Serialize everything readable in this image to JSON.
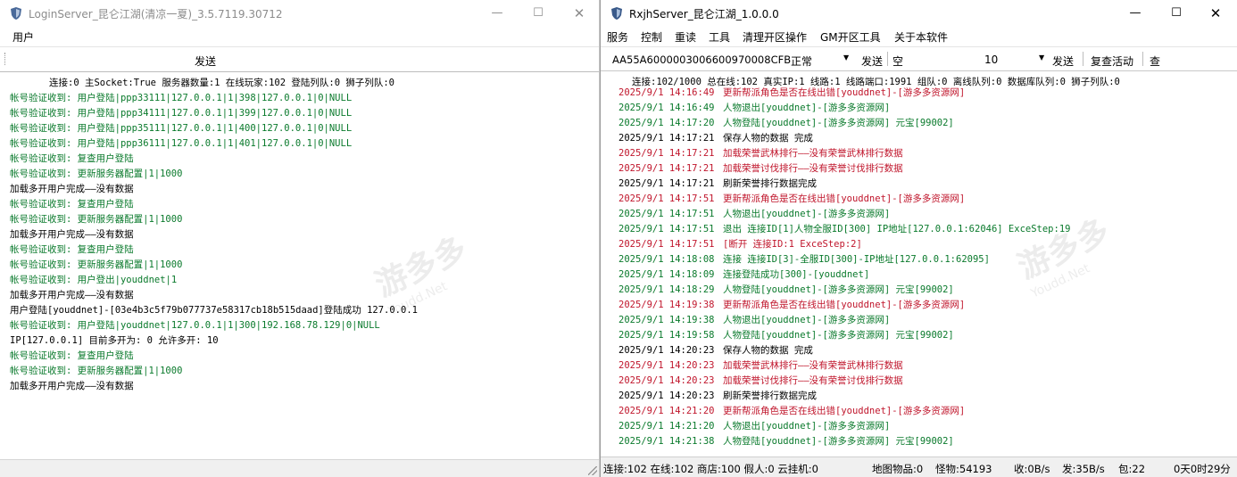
{
  "left_window": {
    "title": "LoginServer_昆仑江湖(清凉一夏)_3.5.7119.30712",
    "menu": [
      "用户"
    ],
    "send_label": "发送",
    "status_header": "连接:0  主Socket:True  服务器数量:1  在线玩家:102  登陆列队:0  狮子列队:0",
    "log": [
      {
        "text": "帐号验证收到: 用户登陆|ppp33111|127.0.0.1|1|398|127.0.0.1|0|NULL",
        "color": "green"
      },
      {
        "text": "帐号验证收到: 用户登陆|ppp34111|127.0.0.1|1|399|127.0.0.1|0|NULL",
        "color": "green"
      },
      {
        "text": "帐号验证收到: 用户登陆|ppp35111|127.0.0.1|1|400|127.0.0.1|0|NULL",
        "color": "green"
      },
      {
        "text": "帐号验证收到: 用户登陆|ppp36111|127.0.0.1|1|401|127.0.0.1|0|NULL",
        "color": "green"
      },
      {
        "text": "帐号验证收到: 复查用户登陆",
        "color": "green"
      },
      {
        "text": "帐号验证收到: 更新服务器配置|1|1000",
        "color": "green"
      },
      {
        "text": "加载多开用户完成——没有数据",
        "color": "black"
      },
      {
        "text": "帐号验证收到: 复查用户登陆",
        "color": "green"
      },
      {
        "text": "帐号验证收到: 更新服务器配置|1|1000",
        "color": "green"
      },
      {
        "text": "加载多开用户完成——没有数据",
        "color": "black"
      },
      {
        "text": "帐号验证收到: 复查用户登陆",
        "color": "green"
      },
      {
        "text": "帐号验证收到: 更新服务器配置|1|1000",
        "color": "green"
      },
      {
        "text": "帐号验证收到: 用户登出|youddnet|1",
        "color": "green"
      },
      {
        "text": "加载多开用户完成——没有数据",
        "color": "black"
      },
      {
        "text": "用户登陆[youddnet]-[03e4b3c5f79b077737e58317cb18b515daad]登陆成功    127.0.0.1",
        "color": "black"
      },
      {
        "text": "帐号验证收到: 用户登陆|youddnet|127.0.0.1|1|300|192.168.78.129|0|NULL",
        "color": "green"
      },
      {
        "text": "IP[127.0.0.1]  目前多开为: 0  允许多开: 10",
        "color": "black"
      },
      {
        "text": "帐号验证收到: 复查用户登陆",
        "color": "green"
      },
      {
        "text": "帐号验证收到: 更新服务器配置|1|1000",
        "color": "green"
      },
      {
        "text": "加载多开用户完成——没有数据",
        "color": "black"
      }
    ]
  },
  "right_window": {
    "title": "RxjhServer_昆仑江湖_1.0.0.0",
    "menu": [
      "服务",
      "控制",
      "重读",
      "工具",
      "清理开区操作",
      "GM开区工具",
      "关于本软件"
    ],
    "toolbar": {
      "code": "AA55A6000003006600970008CFB",
      "mode_value": "正常",
      "send1": "发送",
      "input_value": "空",
      "count_value": "10",
      "send2": "发送",
      "recheck": "复查活动",
      "query": "查"
    },
    "status_header": "连接:102/1000   总在线:102  真实IP:1  线路:1  线路端口:1991  组队:0  离线队列:0  数据库队列:0  狮子列队:0",
    "log": [
      {
        "time": "2025/9/1  14:16:49",
        "text": "更新帮派角色是否在线出错[youddnet]-[游多多资源网]",
        "color": "red"
      },
      {
        "time": "2025/9/1  14:16:49",
        "text": "人物退出[youddnet]-[游多多资源网]",
        "color": "green"
      },
      {
        "time": "2025/9/1  14:17:20",
        "text": "人物登陆[youddnet]-[游多多资源网] 元宝[99002]",
        "color": "green"
      },
      {
        "time": "2025/9/1  14:17:21",
        "text": "保存人物的数据  完成",
        "color": "black"
      },
      {
        "time": "2025/9/1  14:17:21",
        "text": "加载荣誉武林排行——没有荣誉武林排行数据",
        "color": "red"
      },
      {
        "time": "2025/9/1  14:17:21",
        "text": "加载荣誉讨伐排行——没有荣誉讨伐排行数据",
        "color": "red"
      },
      {
        "time": "2025/9/1  14:17:21",
        "text": "刷新荣誉排行数据完成",
        "color": "black"
      },
      {
        "time": "2025/9/1  14:17:51",
        "text": "更新帮派角色是否在线出错[youddnet]-[游多多资源网]",
        "color": "red"
      },
      {
        "time": "2025/9/1  14:17:51",
        "text": "人物退出[youddnet]-[游多多资源网]",
        "color": "green"
      },
      {
        "time": "2025/9/1  14:17:51",
        "text": "退出 连接ID[1]人物全服ID[300] IP地址[127.0.0.1:62046] ExceStep:19",
        "color": "green"
      },
      {
        "time": "2025/9/1  14:17:51",
        "text": "[断开 连接ID:1 ExceStep:2]",
        "color": "red"
      },
      {
        "time": "2025/9/1  14:18:08",
        "text": "连接 连接ID[3]-全服ID[300]-IP地址[127.0.0.1:62095]",
        "color": "green"
      },
      {
        "time": "2025/9/1  14:18:09",
        "text": "连接登陆成功[300]-[youddnet]",
        "color": "green"
      },
      {
        "time": "2025/9/1  14:18:29",
        "text": "人物登陆[youddnet]-[游多多资源网] 元宝[99002]",
        "color": "green"
      },
      {
        "time": "2025/9/1  14:19:38",
        "text": "更新帮派角色是否在线出错[youddnet]-[游多多资源网]",
        "color": "red"
      },
      {
        "time": "2025/9/1  14:19:38",
        "text": "人物退出[youddnet]-[游多多资源网]",
        "color": "green"
      },
      {
        "time": "2025/9/1  14:19:58",
        "text": "人物登陆[youddnet]-[游多多资源网] 元宝[99002]",
        "color": "green"
      },
      {
        "time": "2025/9/1  14:20:23",
        "text": "保存人物的数据  完成",
        "color": "black"
      },
      {
        "time": "2025/9/1  14:20:23",
        "text": "加载荣誉武林排行——没有荣誉武林排行数据",
        "color": "red"
      },
      {
        "time": "2025/9/1  14:20:23",
        "text": "加载荣誉讨伐排行——没有荣誉讨伐排行数据",
        "color": "red"
      },
      {
        "time": "2025/9/1  14:20:23",
        "text": "刷新荣誉排行数据完成",
        "color": "black"
      },
      {
        "time": "2025/9/1  14:21:20",
        "text": "更新帮派角色是否在线出错[youddnet]-[游多多资源网]",
        "color": "red"
      },
      {
        "time": "2025/9/1  14:21:20",
        "text": "人物退出[youddnet]-[游多多资源网]",
        "color": "green"
      },
      {
        "time": "2025/9/1  14:21:38",
        "text": "人物登陆[youddnet]-[游多多资源网] 元宝[99002]",
        "color": "green"
      }
    ],
    "status_bar": [
      "连接:102 在线:102 商店:100 假人:0 云挂机:0",
      "地图物品:0",
      "怪物:54193",
      "收:0B/s",
      "发:35B/s",
      "包:22",
      "0天0时29分"
    ]
  },
  "colors": {
    "log_green": "#0a7a2c",
    "log_red": "#c0162c",
    "log_black": "#000000"
  },
  "watermark": {
    "text_cn": "游多多",
    "text_en": "Youdd.Net"
  }
}
